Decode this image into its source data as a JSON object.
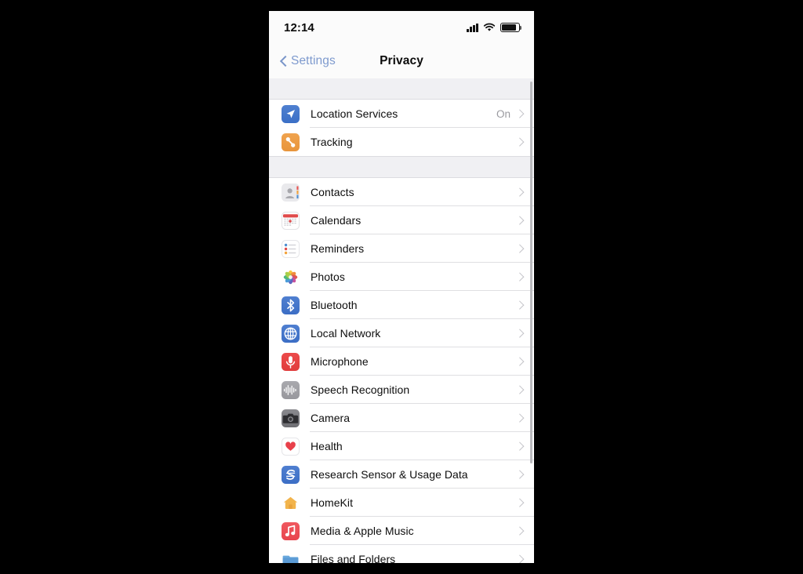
{
  "window": {
    "background_color": "#000000",
    "device_background": "#ffffff"
  },
  "status_bar": {
    "time": "12:14",
    "icons": [
      "cellular-bars-icon",
      "wifi-icon",
      "battery-icon"
    ],
    "battery_level_percent": 88
  },
  "nav_bar": {
    "back_label": "Settings",
    "back_icon": "chevron-left-icon",
    "title": "Privacy",
    "back_color": "#7e9ace",
    "title_color": "#0b0b0b"
  },
  "sections": [
    {
      "id": "location-section",
      "rows": [
        {
          "label": "Location Services",
          "detail": "On",
          "icon": "location-arrow-icon",
          "icon_class": "ic-location",
          "icon_color": "#3b6fc6",
          "accessory": "chevron-right-icon"
        },
        {
          "label": "Tracking",
          "detail": "",
          "icon": "tracking-link-icon",
          "icon_class": "ic-tracking",
          "icon_color": "#e8953c",
          "accessory": "chevron-right-icon"
        }
      ]
    },
    {
      "id": "app-permissions-section",
      "rows": [
        {
          "label": "Contacts",
          "detail": "",
          "icon": "contacts-icon",
          "icon_class": "ic-contacts",
          "icon_color": "#e9e9ec",
          "accessory": "chevron-right-icon"
        },
        {
          "label": "Calendars",
          "detail": "",
          "icon": "calendar-icon",
          "icon_class": "ic-calendars",
          "icon_color": "#e34b4b",
          "accessory": "chevron-right-icon"
        },
        {
          "label": "Reminders",
          "detail": "",
          "icon": "reminders-icon",
          "icon_class": "ic-reminders",
          "icon_color": "#f0a33c",
          "accessory": "chevron-right-icon"
        },
        {
          "label": "Photos",
          "detail": "",
          "icon": "photos-icon",
          "icon_class": "ic-photos",
          "icon_color": "#f5a623",
          "accessory": "chevron-right-icon"
        },
        {
          "label": "Bluetooth",
          "detail": "",
          "icon": "bluetooth-icon",
          "icon_class": "ic-bluetooth",
          "icon_color": "#3c6ec5",
          "accessory": "chevron-right-icon"
        },
        {
          "label": "Local Network",
          "detail": "",
          "icon": "globe-icon",
          "icon_class": "ic-localnet",
          "icon_color": "#3c6ec5",
          "accessory": "chevron-right-icon"
        },
        {
          "label": "Microphone",
          "detail": "",
          "icon": "microphone-icon",
          "icon_class": "ic-microphone",
          "icon_color": "#e03c3c",
          "accessory": "chevron-right-icon"
        },
        {
          "label": "Speech Recognition",
          "detail": "",
          "icon": "waveform-icon",
          "icon_class": "ic-speech",
          "icon_color": "#98989d",
          "accessory": "chevron-right-icon"
        },
        {
          "label": "Camera",
          "detail": "",
          "icon": "camera-icon",
          "icon_class": "ic-camera",
          "icon_color": "#6e6e73",
          "accessory": "chevron-right-icon"
        },
        {
          "label": "Health",
          "detail": "",
          "icon": "heart-icon",
          "icon_class": "ic-health",
          "icon_color": "#e8404a",
          "accessory": "chevron-right-icon"
        },
        {
          "label": "Research Sensor & Usage Data",
          "detail": "",
          "icon": "research-sensor-icon",
          "icon_class": "ic-research",
          "icon_color": "#3c6ec5",
          "accessory": "chevron-right-icon"
        },
        {
          "label": "HomeKit",
          "detail": "",
          "icon": "house-icon",
          "icon_class": "ic-homekit",
          "icon_color": "#f0b64a",
          "accessory": "chevron-right-icon"
        },
        {
          "label": "Media & Apple Music",
          "detail": "",
          "icon": "music-note-icon",
          "icon_class": "ic-media",
          "icon_color": "#e8454e",
          "accessory": "chevron-right-icon"
        },
        {
          "label": "Files and Folders",
          "detail": "",
          "icon": "folder-icon",
          "icon_class": "ic-files",
          "icon_color": "#5b9bd5",
          "accessory": "chevron-right-icon"
        }
      ]
    }
  ],
  "scrollbar": {
    "visible": true,
    "thumb_color": "#b9b9bd"
  }
}
